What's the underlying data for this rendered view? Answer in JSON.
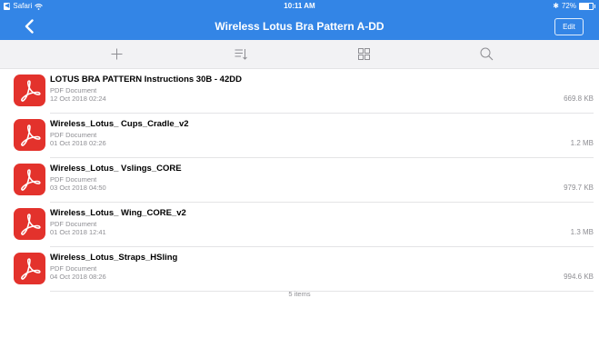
{
  "status_bar": {
    "back_app": "Safari",
    "time": "10:11 AM",
    "battery": "72%",
    "battery_level": 0.72
  },
  "nav": {
    "title": "Wireless Lotus Bra Pattern A-DD",
    "edit_label": "Edit"
  },
  "toolbar": {
    "items": [
      "add-icon",
      "sort-icon",
      "grid-view-icon",
      "search-icon"
    ]
  },
  "files": [
    {
      "name": "LOTUS BRA PATTERN Instructions  30B - 42DD",
      "kind": "PDF Document",
      "date": "12 Oct 2018 02:24",
      "size": "669.8 KB"
    },
    {
      "name": "Wireless_Lotus_ Cups_Cradle_v2",
      "kind": "PDF Document",
      "date": "01 Oct 2018 02:26",
      "size": "1.2 MB"
    },
    {
      "name": "Wireless_Lotus_ Vslings_CORE",
      "kind": "PDF Document",
      "date": "03 Oct 2018 04:50",
      "size": "979.7 KB"
    },
    {
      "name": "Wireless_Lotus_ Wing_CORE_v2",
      "kind": "PDF Document",
      "date": "01 Oct 2018 12:41",
      "size": "1.3 MB"
    },
    {
      "name": "Wireless_Lotus_Straps_HSling",
      "kind": "PDF Document",
      "date": "04 Oct 2018 08:26",
      "size": "994.6 KB"
    }
  ],
  "item_count": "5 items",
  "colors": {
    "accent": "#3385e6",
    "pdf_icon": "#e3322c",
    "toolbar_bg": "#f2f2f4",
    "secondary_text": "#8e8e93"
  }
}
